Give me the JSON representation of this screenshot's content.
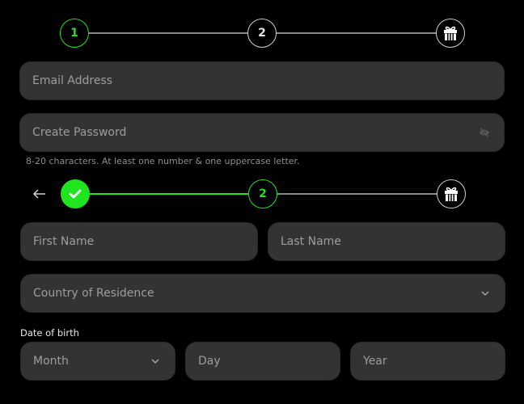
{
  "stepper_top": {
    "steps": [
      {
        "label": "1",
        "state": "active"
      },
      {
        "label": "2",
        "state": "pending"
      },
      {
        "icon": "gift-icon",
        "state": "pending"
      }
    ]
  },
  "account": {
    "email": {
      "placeholder": "Email Address",
      "value": ""
    },
    "password": {
      "placeholder": "Create Password",
      "value": "",
      "toggle_icon": "eye-slash-icon"
    },
    "password_hint": "8-20 characters. At least one number & one uppercase letter."
  },
  "stepper_bottom": {
    "back_icon": "arrow-left-icon",
    "steps": [
      {
        "icon": "check-icon",
        "state": "done"
      },
      {
        "label": "2",
        "state": "active"
      },
      {
        "icon": "gift-icon",
        "state": "pending"
      }
    ]
  },
  "profile": {
    "first_name": {
      "placeholder": "First Name",
      "value": ""
    },
    "last_name": {
      "placeholder": "Last Name",
      "value": ""
    },
    "country": {
      "placeholder": "Country of Residence",
      "icon": "chevron-down-icon"
    },
    "dob_label": "Date of birth",
    "month": {
      "placeholder": "Month",
      "icon": "chevron-down-icon"
    },
    "day": {
      "placeholder": "Day",
      "value": ""
    },
    "year": {
      "placeholder": "Year",
      "value": ""
    }
  },
  "colors": {
    "accent": "#1ee51e",
    "background": "#000000",
    "field": "#333333"
  }
}
